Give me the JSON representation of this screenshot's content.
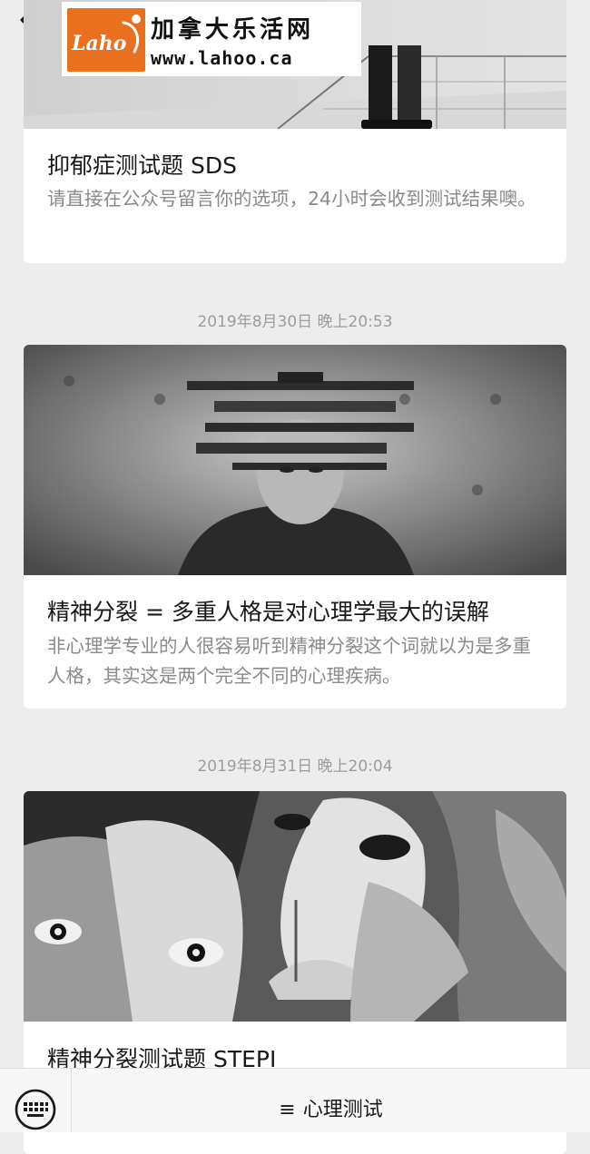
{
  "icons": {
    "back": "chevron-left-icon",
    "more": "more-dots-icon",
    "keyboard": "keyboard-icon",
    "menu": "hamburger-menu-icon"
  },
  "watermark": {
    "logo_text": "Laho",
    "title": "加拿大乐活网",
    "url": "www.lahoo.ca"
  },
  "articles": [
    {
      "title": "抑郁症测试题 SDS",
      "description": "请直接在公众号留言你的选项，24小时会收到测试结果噢。"
    },
    {
      "timestamp": "2019年8月30日 晚上20:53",
      "title": "精神分裂 = 多重人格是对心理学最大的误解",
      "description": "非心理学专业的人很容易听到精神分裂这个词就以为是多重人格，其实这是两个完全不同的心理疾病。"
    },
    {
      "timestamp": "2019年8月31日 晚上20:04",
      "title": "精神分裂测试题 STEPI"
    }
  ],
  "bottom_menu": {
    "glyph": "≡",
    "label": "心理测试"
  },
  "colors": {
    "background": "#ededed",
    "card": "#ffffff",
    "brand_orange": "#e8701e"
  }
}
